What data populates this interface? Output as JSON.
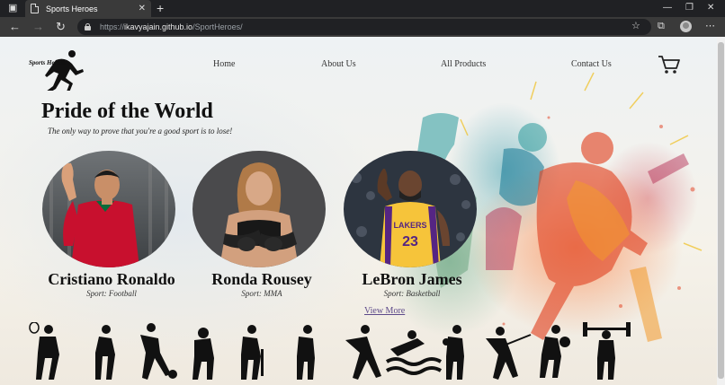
{
  "browser": {
    "tab_title": "Sports Heroes",
    "url_prefix": "https://",
    "url_host": "ikavyajain.github.io",
    "url_path": "/SportHeroes/"
  },
  "site": {
    "logo_text": "Sports Heroes",
    "nav": {
      "home": "Home",
      "about": "About Us",
      "products": "All Products",
      "contact": "Contact Us"
    },
    "hero": {
      "title": "Pride of the World",
      "subtitle": "The only way to prove that you're a good sport is to lose!"
    },
    "athletes": [
      {
        "name": "Cristiano Ronaldo",
        "sport": "Sport: Football"
      },
      {
        "name": "Ronda Rousey",
        "sport": "Sport: MMA"
      },
      {
        "name": "LeBron James",
        "sport": "Sport: Basketball"
      }
    ],
    "view_more": "View More"
  },
  "colors": {
    "chrome_dark": "#202124",
    "chrome_mid": "#3a3a3a",
    "lakers_gold": "#f6c43a",
    "portugal_red": "#c8102e",
    "link": "#5d4a8a"
  },
  "icons": [
    "browser-menu-icon",
    "page-icon",
    "close-icon",
    "plus-icon",
    "back-arrow-icon",
    "forward-arrow-icon",
    "refresh-icon",
    "lock-icon",
    "favorites-star-icon",
    "collections-icon",
    "profile-avatar",
    "more-menu-icon",
    "cart-icon",
    "runner-logo-icon"
  ]
}
